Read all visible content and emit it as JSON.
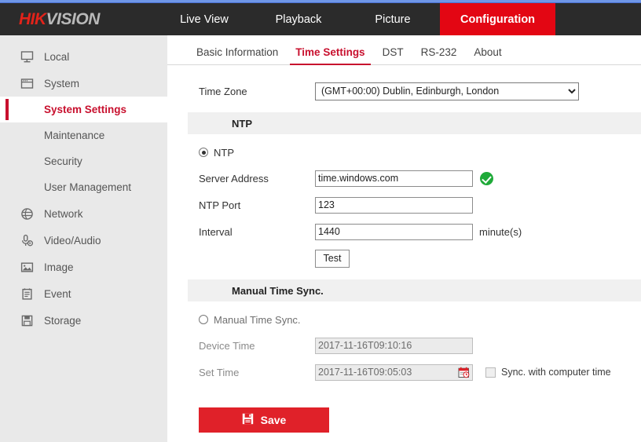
{
  "brand": {
    "logo_hik": "HIK",
    "logo_vision": "VISION"
  },
  "nav": {
    "items": [
      {
        "label": "Live View",
        "active": false
      },
      {
        "label": "Playback",
        "active": false
      },
      {
        "label": "Picture",
        "active": false
      },
      {
        "label": "Configuration",
        "active": true
      }
    ]
  },
  "sidebar": {
    "items": [
      {
        "label": "Local",
        "icon": "monitor-icon"
      },
      {
        "label": "System",
        "icon": "window-icon"
      },
      {
        "label": "System Settings",
        "icon": "",
        "sub": true,
        "active": true
      },
      {
        "label": "Maintenance",
        "icon": "",
        "sub": true
      },
      {
        "label": "Security",
        "icon": "",
        "sub": true
      },
      {
        "label": "User Management",
        "icon": "",
        "sub": true
      },
      {
        "label": "Network",
        "icon": "globe-icon"
      },
      {
        "label": "Video/Audio",
        "icon": "microphone-icon"
      },
      {
        "label": "Image",
        "icon": "picture-icon"
      },
      {
        "label": "Event",
        "icon": "clipboard-icon"
      },
      {
        "label": "Storage",
        "icon": "floppy-disk-icon"
      }
    ]
  },
  "tabs": [
    {
      "label": "Basic Information",
      "active": false
    },
    {
      "label": "Time Settings",
      "active": true
    },
    {
      "label": "DST",
      "active": false
    },
    {
      "label": "RS-232",
      "active": false
    },
    {
      "label": "About",
      "active": false
    }
  ],
  "form": {
    "time_zone_label": "Time Zone",
    "time_zone_value": "(GMT+00:00) Dublin, Edinburgh, London",
    "ntp_section_title": "NTP",
    "ntp_radio_label": "NTP",
    "server_address_label": "Server Address",
    "server_address_value": "time.windows.com",
    "ntp_port_label": "NTP Port",
    "ntp_port_value": "123",
    "interval_label": "Interval",
    "interval_value": "1440",
    "interval_unit": "minute(s)",
    "test_button": "Test",
    "manual_section_title": "Manual Time Sync.",
    "manual_radio_label": "Manual Time Sync.",
    "device_time_label": "Device Time",
    "device_time_value": "2017-11-16T09:10:16",
    "set_time_label": "Set Time",
    "set_time_value": "2017-11-16T09:05:03",
    "sync_checkbox_label": "Sync. with computer time",
    "save_button": "Save"
  },
  "colors": {
    "brand_red": "#e30613",
    "accent_red": "#c8102e",
    "header_dark": "#2b2b2b",
    "sidebar_gray": "#e9e9e9",
    "section_gray": "#f0f0f0",
    "success_green": "#1faa39"
  }
}
